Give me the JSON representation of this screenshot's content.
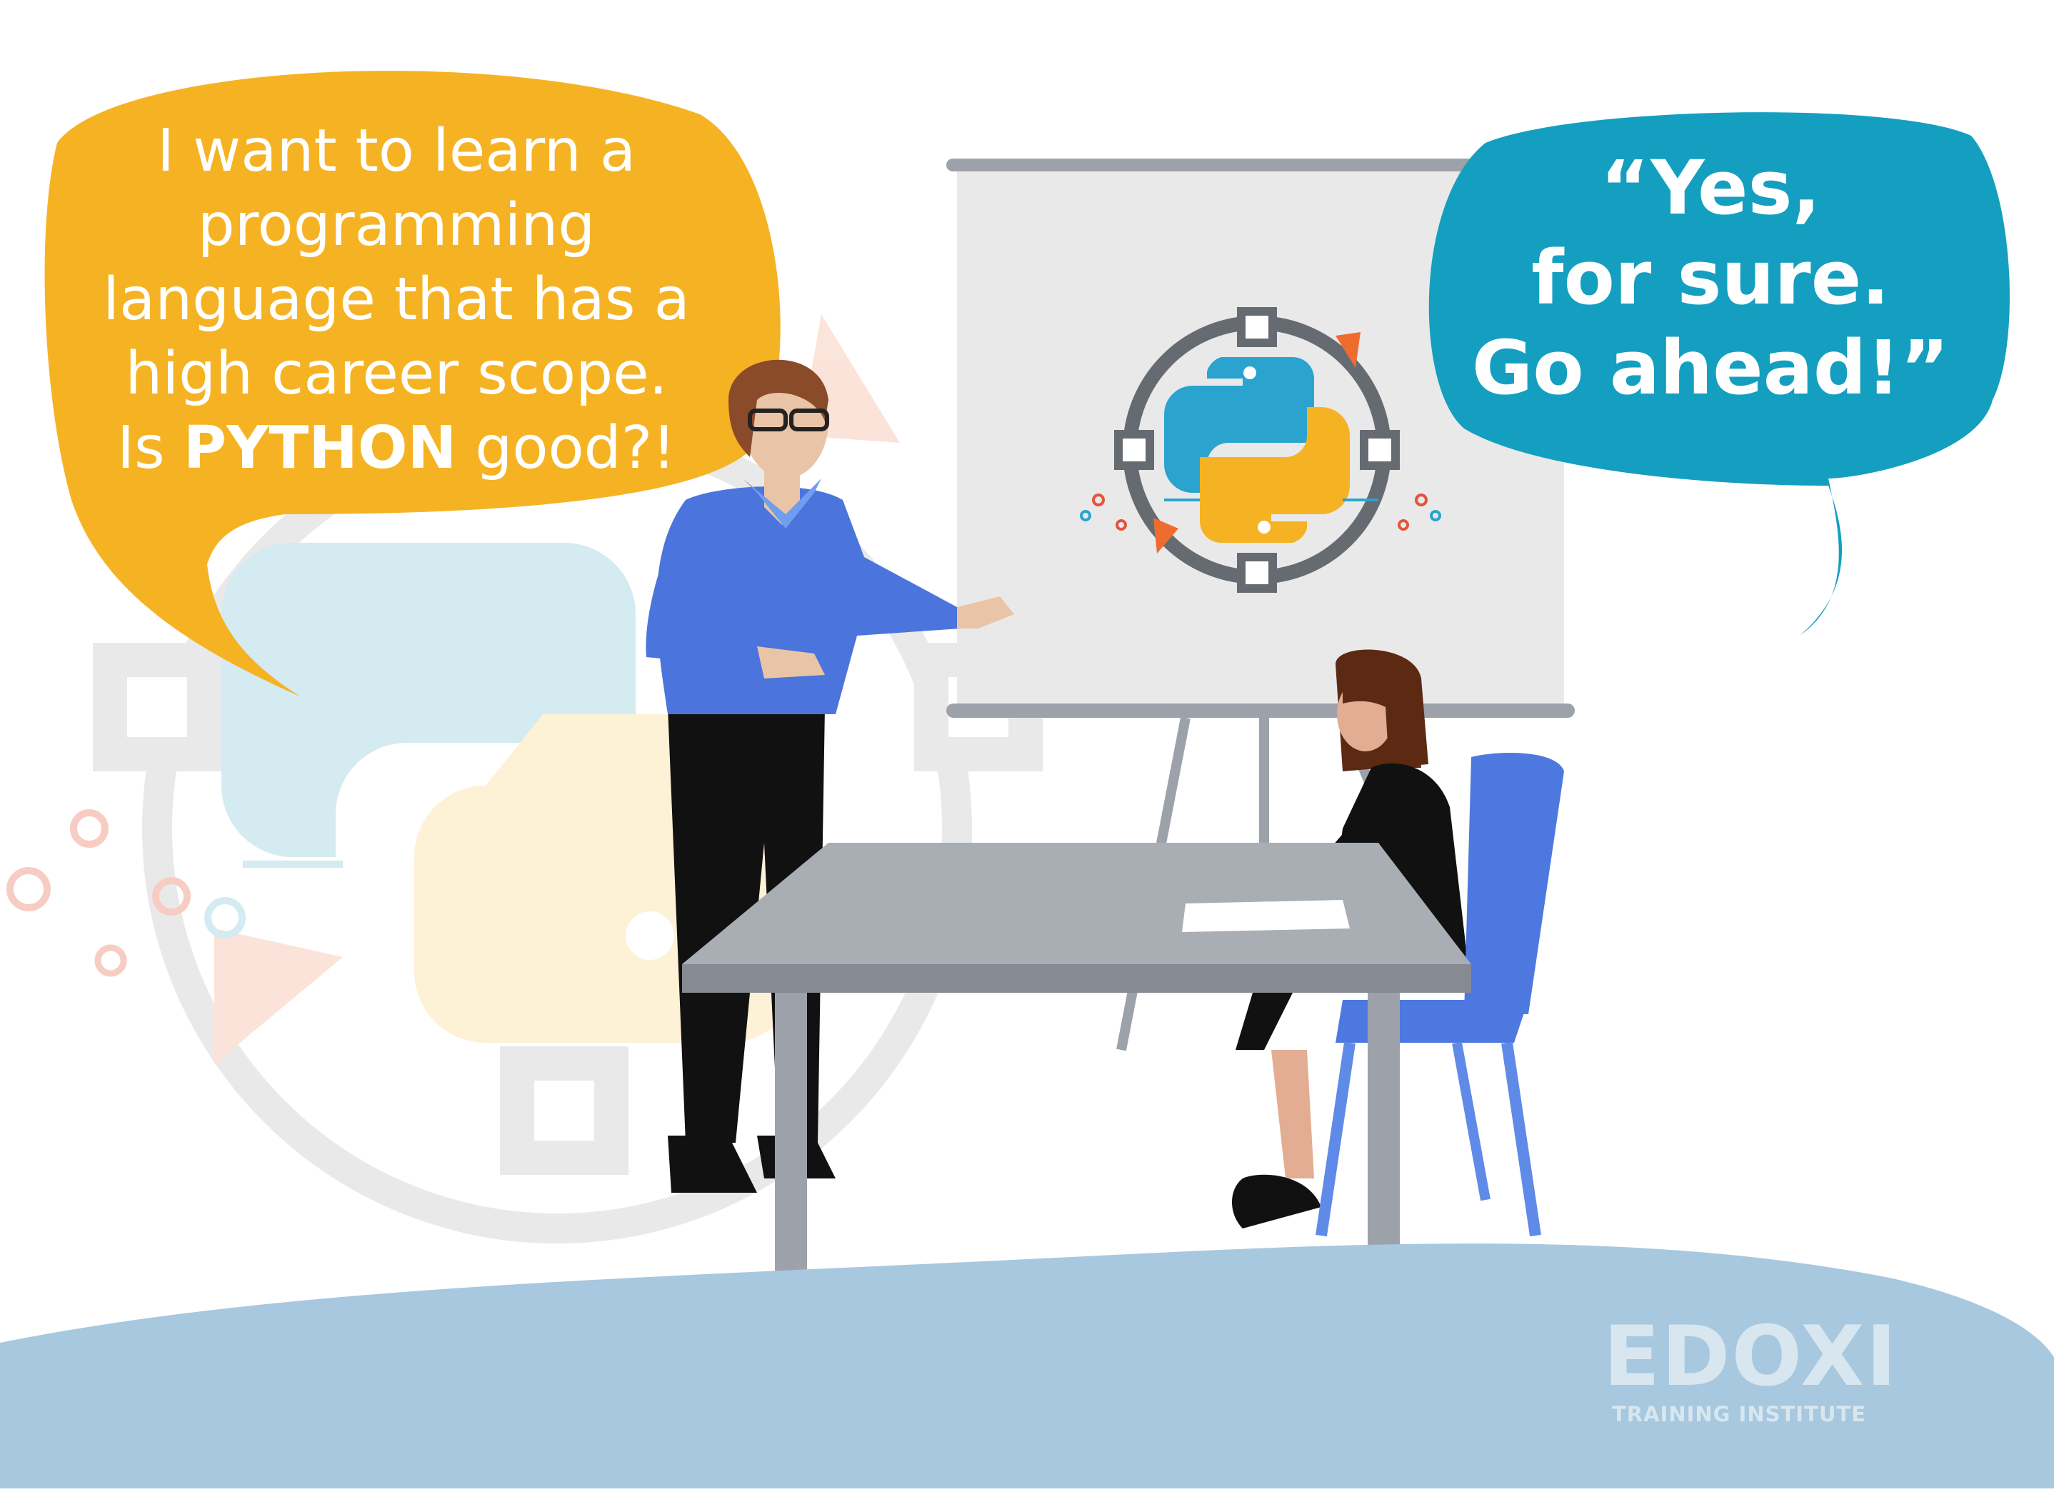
{
  "speech_bubbles": {
    "left": {
      "lines": [
        "I want to learn a",
        "programming",
        "language that has a",
        "high career scope."
      ],
      "last_line_prefix": "Is ",
      "last_line_emphasis": "PYTHON",
      "last_line_suffix": " good?!",
      "color": "#f5b324"
    },
    "right": {
      "lines": [
        "“Yes,",
        "for sure.",
        "Go ahead!”"
      ],
      "color": "#149fc0"
    }
  },
  "logo": {
    "brand": "EDOXI",
    "tagline": "TRAINING INSTITUTE"
  },
  "icons": [
    "python-logo-icon"
  ],
  "colors": {
    "python_blue": "#2aa4cf",
    "python_yellow": "#f5b324",
    "shirt_blue": "#4b74dc",
    "chair_blue": "#4d78e0",
    "table_gray": "#a9adb4",
    "wave_blue": "#a7c8df",
    "accent_orange": "#ef6c2f"
  }
}
